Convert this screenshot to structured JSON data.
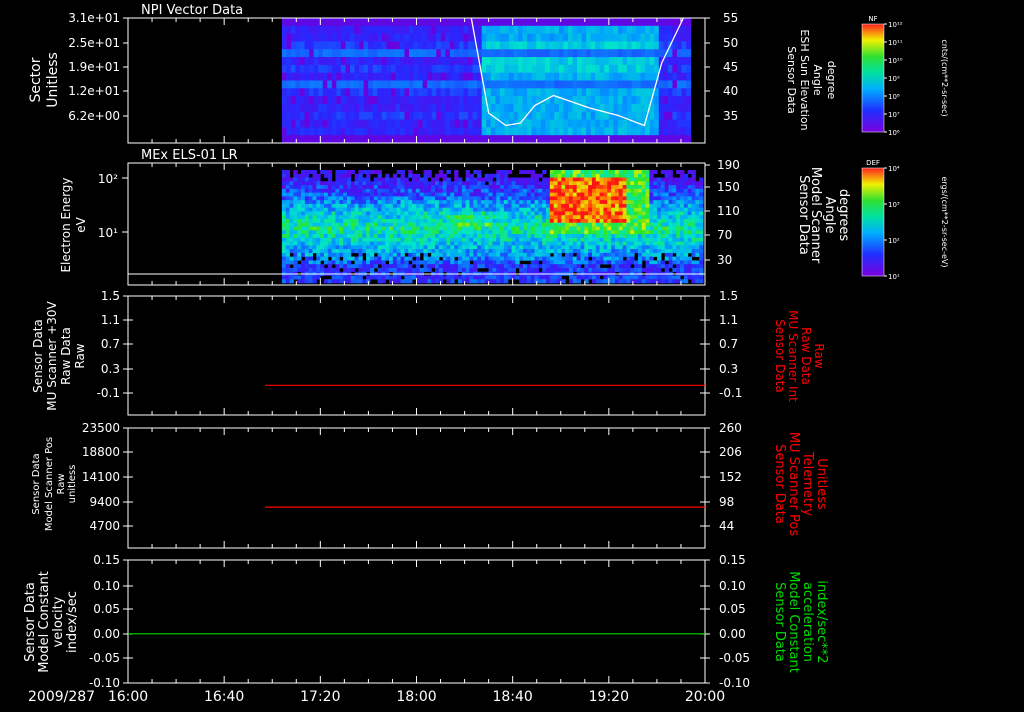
{
  "figure": {
    "date_label": "2009/287",
    "time_ticks": [
      "16:00",
      "16:40",
      "17:20",
      "18:00",
      "18:40",
      "19:20",
      "20:00"
    ],
    "time_range": [
      16.0,
      20.0
    ]
  },
  "chart_data": [
    {
      "type": "heatmap",
      "panel_title": "NPI Vector Data",
      "ylabel": [
        "Sector",
        "Unitless"
      ],
      "y_ticks": [
        "3.1e+01",
        "2.5e+01",
        "1.9e+01",
        "1.2e+01",
        "6.2e+00"
      ],
      "right_ylabel": [
        "Sensor Data",
        "ESH Sun Elevation",
        "Angle",
        "degree"
      ],
      "right_ticks": [
        "55",
        "50",
        "45",
        "40",
        "35"
      ],
      "right_range": [
        30,
        55
      ],
      "data_start": "17:04",
      "colorbar": {
        "title": "NF",
        "unit": "cnts/(cm**2-sr-sec)",
        "ticks": [
          "10¹²",
          "10¹¹",
          "10¹⁰",
          "10⁹",
          "10⁸",
          "10⁷",
          "10⁶"
        ]
      },
      "overlay_line": {
        "x": [
          18.38,
          18.5,
          18.62,
          18.72,
          18.82,
          18.95,
          19.2,
          19.4,
          19.58,
          19.7,
          19.85
        ],
        "y": [
          55,
          36,
          33.5,
          34,
          37.5,
          39.5,
          37,
          35.5,
          33.5,
          46,
          55
        ]
      }
    },
    {
      "type": "heatmap",
      "panel_title": "MEx ELS-01 LR",
      "ylabel": [
        "Electron Energy",
        "eV"
      ],
      "y_ticks": [
        "10²",
        "10¹"
      ],
      "right_ylabel": [
        "Sensor Data",
        "Model Scanner",
        "Angle",
        "degrees"
      ],
      "right_ticks": [
        "190",
        "150",
        "110",
        "70",
        "30"
      ],
      "data_start": "17:04",
      "colorbar": {
        "title": "DEF",
        "unit": "ergs/(cm**2-sr-sec-eV)",
        "ticks": [
          "10⁴",
          "10³",
          "10²",
          "10¹"
        ]
      }
    },
    {
      "type": "line",
      "ylabel": [
        "Sensor Data",
        "MU Scanner +30V",
        "Raw Data",
        "Raw"
      ],
      "y_ticks": [
        "1.5",
        "1.1",
        "0.7",
        "0.3",
        "-0.1"
      ],
      "ylim": [
        -0.5,
        1.5
      ],
      "right_ylabel": [
        "Sensor Data",
        "MU Scanner Int",
        "Raw Data",
        "Raw"
      ],
      "right_ticks": [
        "1.5",
        "1.1",
        "0.7",
        "0.3",
        "-0.1"
      ],
      "series": [
        {
          "x": [
            16.95,
            20.0
          ],
          "values": [
            0,
            0
          ],
          "color": "#ff0000"
        }
      ],
      "right_label_color": "#ff0000"
    },
    {
      "type": "line",
      "ylabel": [
        "Sensor Data",
        "Model Scanner Pos",
        "Raw",
        "unitless"
      ],
      "y_ticks": [
        "23500",
        "18800",
        "14100",
        "9400",
        "4700"
      ],
      "ylim": [
        0,
        23500
      ],
      "right_ylabel": [
        "Sensor Data",
        "MU Scanner Pos",
        "Telemetry",
        "Unitless"
      ],
      "right_ticks": [
        "260",
        "206",
        "152",
        "98",
        "44"
      ],
      "series": [
        {
          "x": [
            16.95,
            20.0
          ],
          "values": [
            8000,
            8000
          ],
          "color": "#ff0000"
        }
      ],
      "right_label_color": "#ff0000"
    },
    {
      "type": "line",
      "ylabel": [
        "Sensor Data",
        "Model Constant",
        "velocity",
        "index/sec"
      ],
      "y_ticks": [
        "0.15",
        "0.10",
        "0.05",
        "0.00",
        "-0.05",
        "-0.10"
      ],
      "ylim": [
        -0.1,
        0.15
      ],
      "right_ylabel": [
        "Sensor Data",
        "Model Constant",
        "acceleration",
        "index/sec**2"
      ],
      "right_ticks": [
        "0.15",
        "0.10",
        "0.05",
        "0.00",
        "-0.05",
        "-0.10"
      ],
      "series": [
        {
          "x": [
            16.0,
            20.0
          ],
          "values": [
            0,
            0
          ],
          "color": "#00dd00"
        }
      ],
      "right_label_color": "#00dd00"
    }
  ]
}
